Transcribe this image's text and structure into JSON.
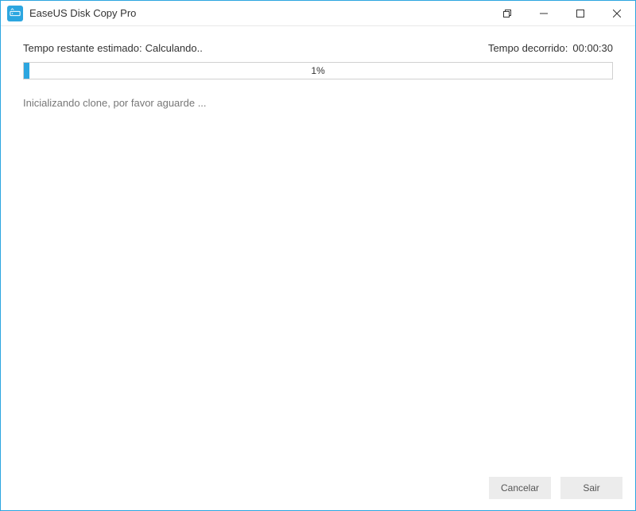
{
  "titlebar": {
    "app_title": "EaseUS Disk Copy Pro"
  },
  "info": {
    "remaining_label": "Tempo restante estimado:",
    "remaining_value": "Calculando..",
    "elapsed_label": "Tempo decorrido:",
    "elapsed_value": "00:00:30"
  },
  "progress": {
    "percent": 1,
    "percent_label": "1%"
  },
  "status": {
    "message": "Inicializando clone, por favor aguarde ..."
  },
  "footer": {
    "cancel_label": "Cancelar",
    "exit_label": "Sair"
  }
}
